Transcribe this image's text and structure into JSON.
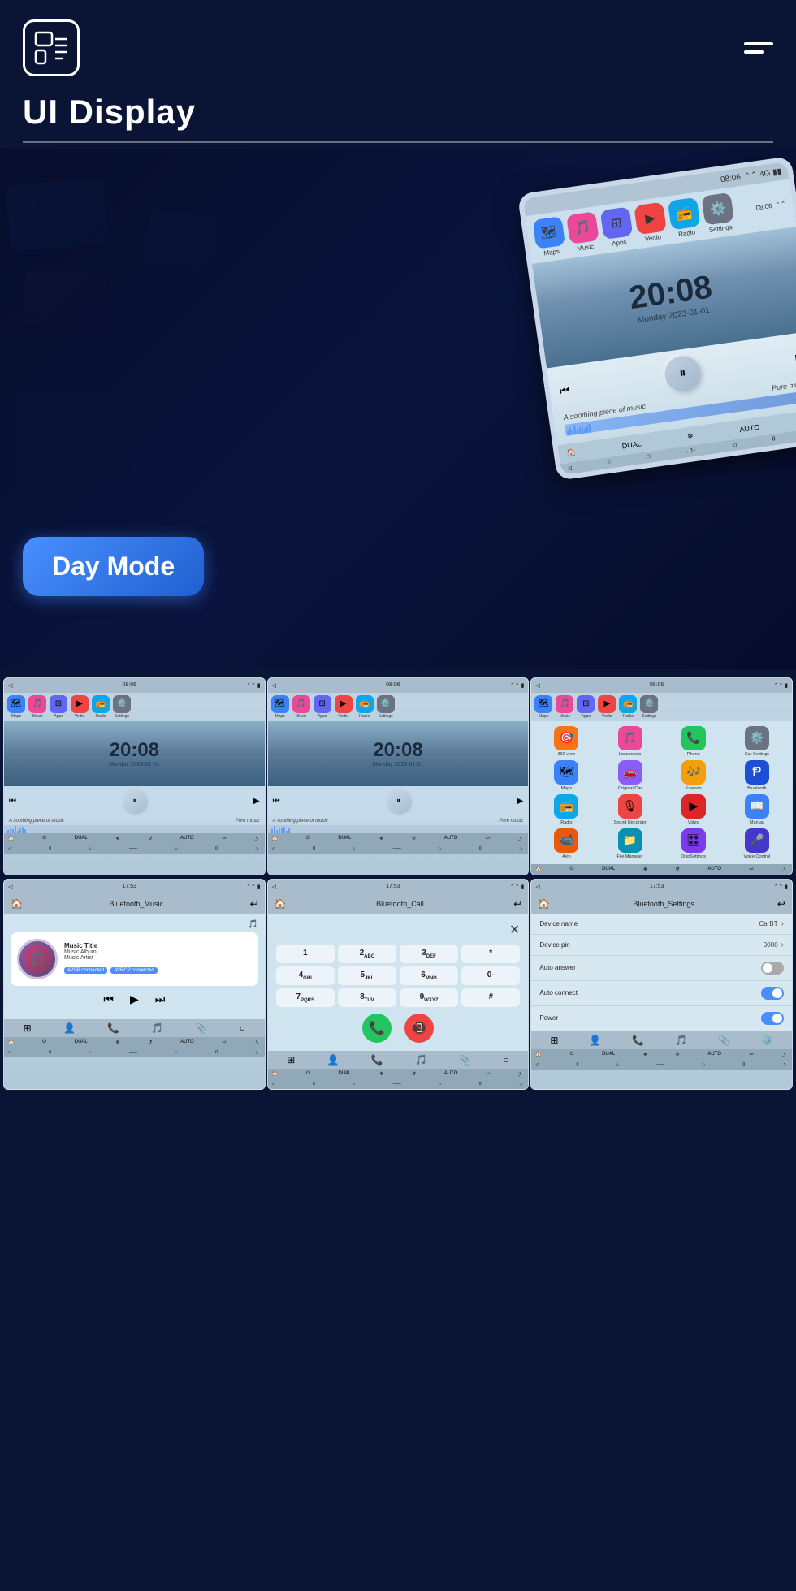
{
  "header": {
    "title": "UI Display",
    "menu_icon": "≡"
  },
  "hero": {
    "day_mode_label": "Day Mode",
    "tablet": {
      "status_time": "08:06",
      "clock_time": "20:08",
      "clock_date": "Monday  2023-01-01",
      "music_label": "A soothing piece of music",
      "music_right": "Pure music",
      "mode_label": "DUAL",
      "auto_label": "AUTO"
    }
  },
  "row1": {
    "screens": [
      {
        "status_time": "08:06",
        "clock_time": "20:08",
        "clock_date": "Monday  2023-01-01",
        "music_label": "A soothing piece of music",
        "music_right": "Pure music"
      },
      {
        "status_time": "08:06",
        "clock_time": "20:08",
        "clock_date": "Monday  2023-01-01",
        "music_label": "A soothing piece of music",
        "music_right": "Pure music"
      }
    ],
    "app_screen": {
      "status_time": "08:06",
      "apps": [
        {
          "label": "360 view",
          "color": "#f97316",
          "icon": "🎯"
        },
        {
          "label": "Localmusic",
          "color": "#ec4899",
          "icon": "🎵"
        },
        {
          "label": "Phone",
          "color": "#22c55e",
          "icon": "📞"
        },
        {
          "label": "Car Settings",
          "color": "#6b7280",
          "icon": "⚙️"
        },
        {
          "label": "Maps",
          "color": "#3b82f6",
          "icon": "🗺"
        },
        {
          "label": "Original Car",
          "color": "#8b5cf6",
          "icon": "🚗"
        },
        {
          "label": "Kuwooo",
          "color": "#f59e0b",
          "icon": "🎶"
        },
        {
          "label": "Bluetooth",
          "color": "#1d4ed8",
          "icon": "Ᵽ"
        },
        {
          "label": "Radio",
          "color": "#0ea5e9",
          "icon": "📻"
        },
        {
          "label": "Sound Recorder",
          "color": "#ef4444",
          "icon": "🎙"
        },
        {
          "label": "Video",
          "color": "#dc2626",
          "icon": "▶"
        },
        {
          "label": "Manual",
          "color": "#3b82f6",
          "icon": "📖"
        },
        {
          "label": "Avin",
          "color": "#ea580c",
          "icon": "📹"
        },
        {
          "label": "File Manager",
          "color": "#0891b2",
          "icon": "📁"
        },
        {
          "label": "DispSettings",
          "color": "#7c3aed",
          "icon": "🎛"
        },
        {
          "label": "Voice Control",
          "color": "#4338ca",
          "icon": "🎤"
        }
      ]
    }
  },
  "row2": {
    "bt_music": {
      "status_time": "17:53",
      "header_title": "Bluetooth_Music",
      "music_title": "Music Title",
      "music_album": "Music Album",
      "music_artist": "Music Artist",
      "badge1": "A2DP connected",
      "badge2": "AVRCP connected"
    },
    "bt_call": {
      "status_time": "17:53",
      "header_title": "Bluetooth_Call",
      "keys": [
        "1",
        "2ABC",
        "3DEF",
        "*",
        "4GHI",
        "5JKL",
        "6MNO",
        "0-",
        "7PQRS",
        "8TUV",
        "9WXYZ",
        "#"
      ]
    },
    "bt_settings": {
      "status_time": "17:53",
      "header_title": "Bluetooth_Settings",
      "device_name_label": "Device name",
      "device_name_value": "CarBT",
      "device_pin_label": "Device pin",
      "device_pin_value": "0000",
      "auto_answer_label": "Auto answer",
      "auto_answer_state": "off",
      "auto_connect_label": "Auto connect",
      "auto_connect_state": "on",
      "power_label": "Power",
      "power_state": "on"
    }
  },
  "nav_apps": [
    {
      "label": "Maps",
      "color": "#3b82f6"
    },
    {
      "label": "Music",
      "color": "#ec4899"
    },
    {
      "label": "Apps",
      "color": "#6366f1"
    },
    {
      "label": "Vedio",
      "color": "#ef4444"
    },
    {
      "label": "Radio",
      "color": "#0ea5e9"
    },
    {
      "label": "Settings",
      "color": "#6b7280"
    }
  ]
}
